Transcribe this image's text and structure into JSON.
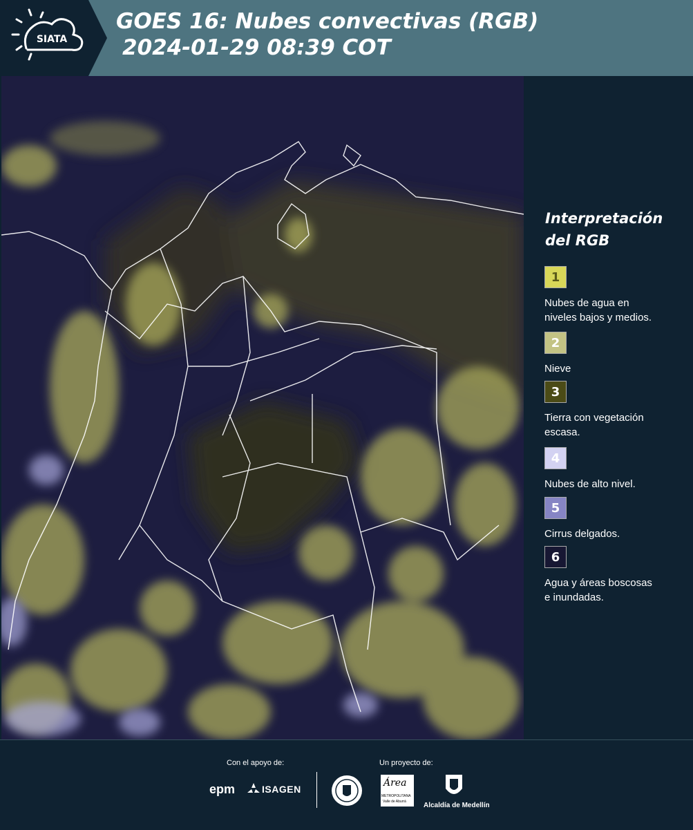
{
  "header": {
    "logo_text": "SIATA",
    "title_line1": "GOES 16: Nubes convectivas (RGB)",
    "title_line2": "2024-01-29 08:39 COT"
  },
  "legend": {
    "title_line1": "Interpretación",
    "title_line2": "del RGB",
    "items": [
      {
        "num": "1",
        "label_line1": "Nubes de agua en",
        "label_line2": "niveles bajos y medios.",
        "color": "#d8d758",
        "num_color": "#5a5a1a"
      },
      {
        "num": "2",
        "label_line1": "Nieve",
        "label_line2": "",
        "color": "#c3c384",
        "num_color": "#ffffff"
      },
      {
        "num": "3",
        "label_line1": "Tierra con vegetación",
        "label_line2": "escasa.",
        "color": "#4b4b16",
        "num_color": "#ffffff"
      },
      {
        "num": "4",
        "label_line1": "Nubes de alto nivel.",
        "label_line2": "",
        "color": "#d3d2f2",
        "num_color": "#ffffff"
      },
      {
        "num": "5",
        "label_line1": "Cirrus delgados.",
        "label_line2": "",
        "color": "#8685c4",
        "num_color": "#ffffff"
      },
      {
        "num": "6",
        "label_line1": "Agua y áreas boscosas",
        "label_line2": "e inundadas.",
        "color": "#171733",
        "num_color": "#ffffff"
      }
    ]
  },
  "footer": {
    "support_label": "Con el apoyo de:",
    "project_label": "Un proyecto de:",
    "sponsor_epm": "epm",
    "sponsor_isagen": "ISAGEN",
    "area_logo_main": "Área",
    "area_logo_sub1": "METROPOLITANA",
    "area_logo_sub2": "Valle de Aburrá",
    "alcaldia": "Alcaldía de Medellín"
  }
}
